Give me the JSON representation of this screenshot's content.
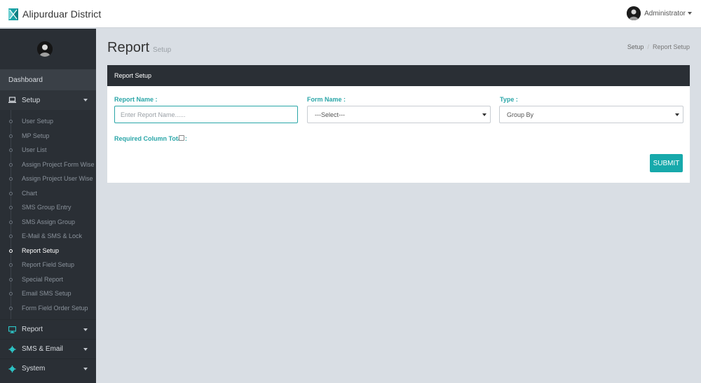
{
  "app": {
    "title": "Alipurduar District"
  },
  "user": {
    "name": "Administrator"
  },
  "sidebar": {
    "dashboard_label": "Dashboard",
    "setup_label": "Setup",
    "setup_items": [
      "User Setup",
      "MP Setup",
      "User List",
      "Assign Project Form Wise",
      "Assign Project User Wise",
      "Chart",
      "SMS Group Entry",
      "SMS Assign Group",
      "E-Mail & SMS & Lock",
      "Report Setup",
      "Report Field Setup",
      "Special Report",
      "Email SMS Setup",
      "Form Field Order Setup"
    ],
    "active_item": "Report Setup",
    "report_label": "Report",
    "sms_email_label": "SMS & Email",
    "system_label": "System"
  },
  "page": {
    "title": "Report",
    "subtitle": "Setup",
    "breadcrumb": [
      "Setup",
      "Report Setup"
    ]
  },
  "panel": {
    "title": "Report Setup",
    "report_name_label": "Report Name :",
    "report_name_placeholder": "Enter Report Name......",
    "report_name_value": "",
    "form_name_label": "Form Name :",
    "form_name_value": "---Select---",
    "type_label": "Type :",
    "type_value": "Group By",
    "required_total_label": "Required Column Total :",
    "required_total_checked": false,
    "submit_label": "SUBMIT"
  },
  "colors": {
    "accent": "#17a9ab",
    "sidebar_bg": "#2a2f35",
    "content_bg": "#d9dee4"
  },
  "icons": {
    "brand": "brand-logo-icon",
    "setup": "laptop-icon",
    "report": "monitor-icon",
    "sms_email": "gear-icon",
    "system": "gear-icon"
  }
}
